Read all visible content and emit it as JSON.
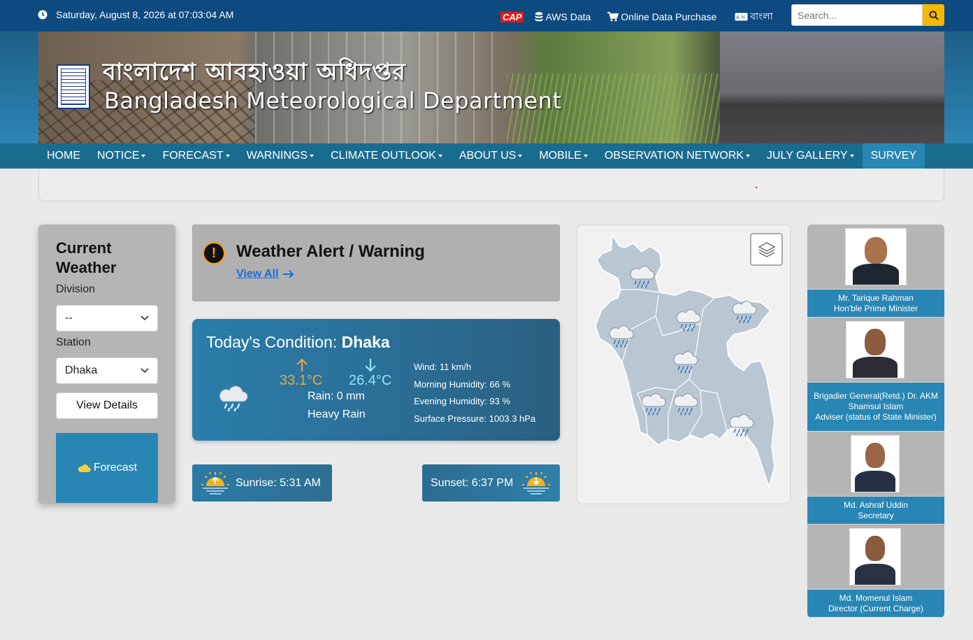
{
  "topbar": {
    "datetime": "Saturday, August 8, 2026 at 07:03:04 AM",
    "cap_label": "CAP",
    "aws_label": "AWS Data",
    "purchase_label": "Online Data Purchase",
    "language_label": "বাংলা",
    "search_placeholder": "Search..."
  },
  "banner": {
    "title_bn": "বাংলাদেশ আবহাওয়া অধিদপ্তর",
    "title_en": "Bangladesh Meteorological Department"
  },
  "nav": {
    "items": [
      {
        "label": "HOME",
        "dropdown": false
      },
      {
        "label": "NOTICE",
        "dropdown": true
      },
      {
        "label": "FORECAST",
        "dropdown": true
      },
      {
        "label": "WARNINGS",
        "dropdown": true
      },
      {
        "label": "CLIMATE OUTLOOK",
        "dropdown": true
      },
      {
        "label": "ABOUT US",
        "dropdown": true
      },
      {
        "label": "MOBILE",
        "dropdown": true
      },
      {
        "label": "OBSERVATION NETWORK",
        "dropdown": true
      },
      {
        "label": "JULY GALLERY",
        "dropdown": true
      },
      {
        "label": "SURVEY",
        "dropdown": false
      }
    ]
  },
  "current_weather": {
    "title": "Current Weather",
    "division_label": "Division",
    "division_value": "--",
    "station_label": "Station",
    "station_value": "Dhaka",
    "view_details": "View Details",
    "forecast": "Forecast"
  },
  "alert": {
    "title": "Weather Alert / Warning",
    "view_all": "View All"
  },
  "today": {
    "prefix": "Today's Condition:",
    "station": "Dhaka",
    "max_temp": "33.1°C",
    "min_temp": "26.4°C",
    "rain": "Rain: 0 mm",
    "condition": "Heavy Rain",
    "wind": "Wind: 11 km/h",
    "morning_humidity": "Morning Humidity: 66 %",
    "evening_humidity": "Evening Humidity: 93 %",
    "pressure": "Surface Pressure: 1003.3 hPa"
  },
  "sun": {
    "sunrise": "Sunrise: 5:31 AM",
    "sunset": "Sunset: 6:37 PM"
  },
  "officials": [
    {
      "name": "Mr. Tarique Rahman",
      "role": "Hon'ble Prime Minister"
    },
    {
      "name": "Brigadier General(Retd.) Dr. AKM Shamsul Islam",
      "role": "Adviser (status of State Minister)"
    },
    {
      "name": "Md. Ashraf Uddin",
      "role": "Secretary"
    },
    {
      "name": "Md. Momenul Islam",
      "role": "Director (Current Charge)"
    }
  ],
  "colors": {
    "topbar": "#0d4a80",
    "nav": "#1a6c8f",
    "accent": "#2886b4",
    "search_button": "#f5b800",
    "max_temp": "#f2a33a",
    "min_temp": "#8fe6f5"
  }
}
